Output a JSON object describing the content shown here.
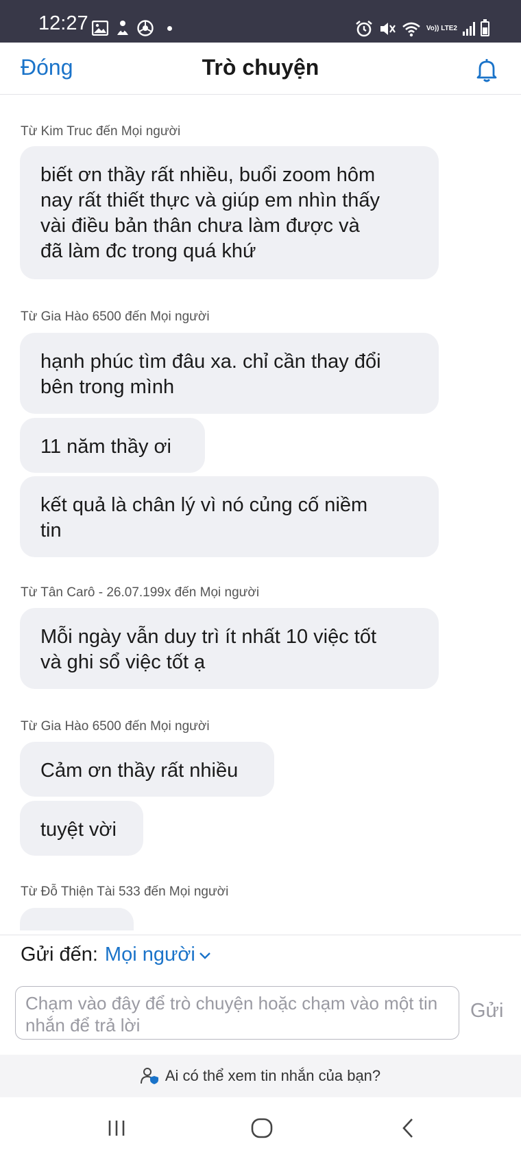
{
  "status_bar": {
    "time": "12:27",
    "network_label": "Vo)) LTE2"
  },
  "header": {
    "close_label": "Đóng",
    "title": "Trò chuyện"
  },
  "messages": [
    {
      "sender": "Từ Kim Truc đến Mọi người",
      "lines": [
        "biết ơn thầy rất nhiều, buổi zoom hôm",
        "nay rất thiết thực và giúp em nhìn thấy",
        "vài điều bản thân chưa làm được và",
        "đã làm đc trong quá khứ"
      ]
    },
    {
      "sender": "Từ Gia Hào 6500 đến Mọi người",
      "lines": [
        "hạnh phúc tìm đâu xa. chỉ cần thay đổi",
        "bên trong mình"
      ]
    },
    {
      "lines": [
        "11 năm thầy ơi"
      ]
    },
    {
      "lines": [
        "kết quả là chân lý vì nó củng cố niềm",
        "tin"
      ]
    },
    {
      "sender": "Từ Tân Carô - 26.07.199x đến Mọi người",
      "lines": [
        "Mỗi ngày vẫn duy trì ít nhất 10 việc tốt",
        "và ghi sổ việc tốt ạ"
      ]
    },
    {
      "sender": "Từ Gia Hào 6500 đến Mọi người",
      "lines": [
        "Cảm ơn thầy rất nhiều"
      ]
    },
    {
      "lines": [
        "tuyệt vời"
      ]
    },
    {
      "sender": "Từ Đỗ Thiện Tài 533 đến Mọi người",
      "lines": [
        ""
      ]
    }
  ],
  "compose": {
    "send_to_label": "Gửi đến:",
    "recipient": "Mọi người",
    "input_placeholder": "Chạm vào đây để trò chuyện hoặc chạm vào một tin nhắn để trả lời",
    "send_label": "Gửi"
  },
  "privacy_notice": "Ai có thể xem tin nhắn của bạn?",
  "colors": {
    "accent": "#1a73c9",
    "bubble": "#eff0f4",
    "status_bar": "#383848"
  }
}
